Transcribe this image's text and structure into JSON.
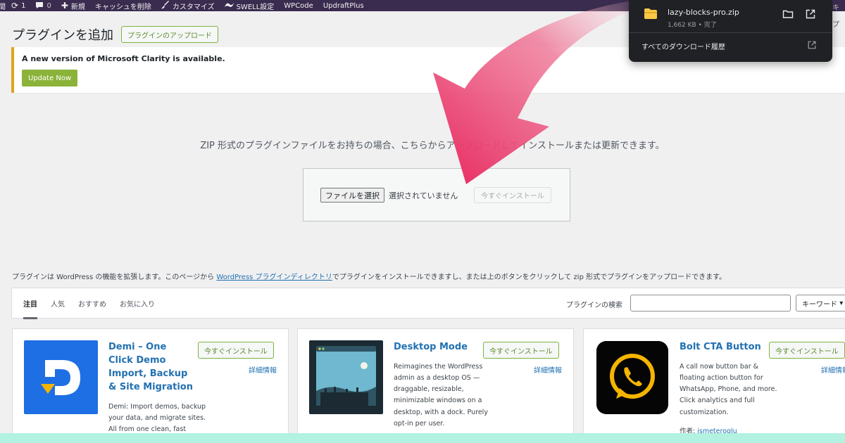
{
  "adminbar": {
    "first_item": "間",
    "updates_count": "1",
    "comments_count": "0",
    "new_label": "新規",
    "cache_label": "キャッシュを削除",
    "customize_label": "カスタマイズ",
    "swell_label": "SWELL設定",
    "wpcode_label": "WPCode",
    "updraft_label": "UpdraftPlus",
    "right_partial": "キ"
  },
  "header": {
    "title": "プラグインを追加",
    "upload_button": "プラグインのアップロード"
  },
  "notice": {
    "text": "A new version of Microsoft Clarity is available.",
    "button": "Update Now"
  },
  "upload": {
    "description": "ZIP 形式のプラグインファイルをお持ちの場合、こちらからアップロードしてインストールまたは更新できます。",
    "choose_file": "ファイルを選択",
    "no_file": "選択されていません",
    "install_now": "今すぐインストール"
  },
  "intro": {
    "before": "プラグインは WordPress の機能を拡張します。このページから ",
    "link": "WordPress プラグインディレクトリ",
    "after": "でプラグインをインストールできますし、または上のボタンをクリックして zip 形式でプラグインをアップロードできます。"
  },
  "filter": {
    "tabs": [
      "注目",
      "人気",
      "おすすめ",
      "お気に入り"
    ],
    "search_label": "プラグインの検索",
    "search_value": "",
    "select_value": "キーワード"
  },
  "plugins": [
    {
      "title": "Demi – One Click Demo Import, Backup & Site Migration",
      "install": "今すぐインストール",
      "details": "詳細情報",
      "description": "Demi: Import demos, backup your data, and migrate sites. All from one clean, fast",
      "icon": "demi-logo-icon",
      "icon_color": "#1e6fe3"
    },
    {
      "title": "Desktop Mode",
      "install": "今すぐインストール",
      "details": "詳細情報",
      "description": "Reimagines the WordPress admin as a desktop OS — draggable, resizable, minimizable windows on a desktop, with a dock. Purely opt-in per user.",
      "icon": "desktop-mode-icon",
      "icon_color": "#1e3a4c"
    },
    {
      "title": "Bolt CTA Button",
      "install": "今すぐインストール",
      "details": "詳細情報",
      "description": "A call now button bar & floating action button for WhatsApp, Phone, and more. Click analytics and full customization.",
      "author_label": "作者: ",
      "author": "ismeteroglu",
      "icon": "whatsapp-bolt-icon",
      "icon_color": "#f5b400"
    }
  ],
  "download": {
    "filename": "lazy-blocks-pro.zip",
    "meta": "1,662 KB • 完了",
    "history": "すべてのダウンロード履歴",
    "right_partial": "プ"
  },
  "colors": {
    "adminbar": "#3a2c4f",
    "accent_green": "#7cb342",
    "link_blue": "#2271b1",
    "arrow_pink": "#e8265e",
    "notice_border": "#dba617"
  }
}
